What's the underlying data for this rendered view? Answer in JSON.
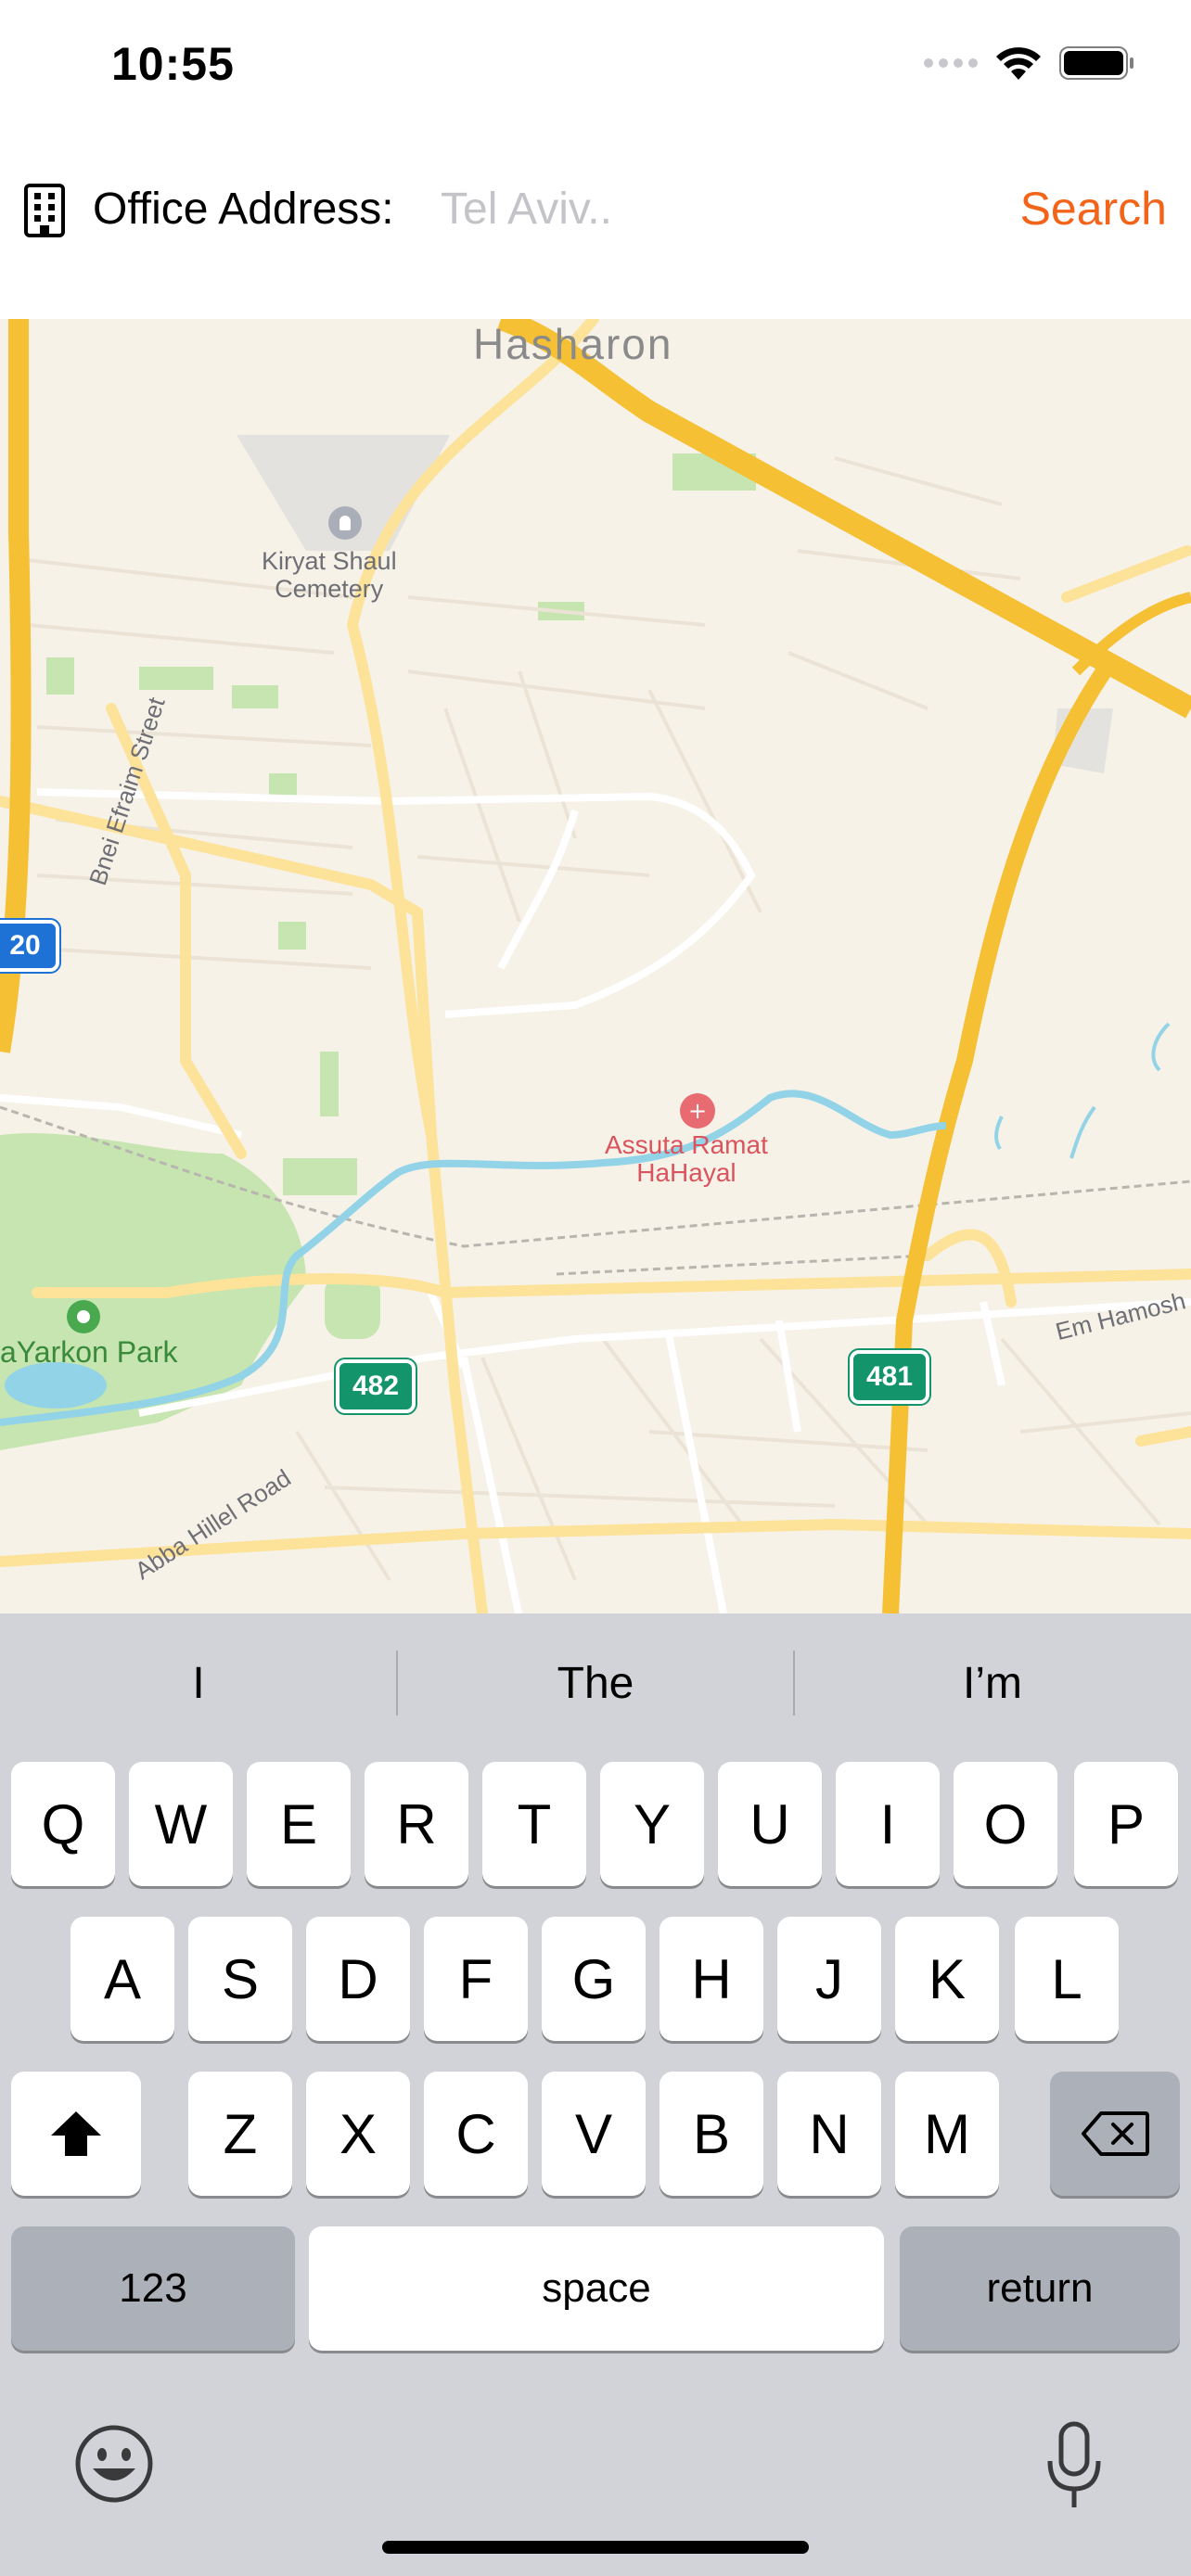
{
  "status_bar": {
    "time": "10:55",
    "icons": [
      "cellular-signal-icon",
      "wifi-icon",
      "battery-icon"
    ]
  },
  "address_bar": {
    "icon": "building-icon",
    "label": "Office Address:",
    "placeholder": "Tel Aviv..",
    "value": "",
    "search_label": "Search"
  },
  "map": {
    "labels": {
      "area": "Hasharon",
      "cemetery_line1": "Kiryat Shaul",
      "cemetery_line2": "Cemetery",
      "street_bnei_efraim": "Bnei Efraim Street",
      "highway_20": "20",
      "hospital_line1": "Assuta Ramat",
      "hospital_line2": "HaHayal",
      "park": "aYarkon Park",
      "route_482": "482",
      "route_481": "481",
      "street_abba_hillel": "Abba Hillel Road",
      "street_em_hamosh": "Em Hamosh"
    },
    "colors": {
      "land": "#f7f2e8",
      "highway": "#f7c844",
      "road": "#ffffff",
      "park": "#c6e5b0",
      "water": "#92d3e8"
    }
  },
  "keyboard": {
    "suggestions": [
      "I",
      "The",
      "I’m"
    ],
    "row1": [
      "Q",
      "W",
      "E",
      "R",
      "T",
      "Y",
      "U",
      "I",
      "O",
      "P"
    ],
    "row2": [
      "A",
      "S",
      "D",
      "F",
      "G",
      "H",
      "J",
      "K",
      "L"
    ],
    "row3": [
      "Z",
      "X",
      "C",
      "V",
      "B",
      "N",
      "M"
    ],
    "numbers_label": "123",
    "space_label": "space",
    "return_label": "return",
    "icons": [
      "shift-icon",
      "backspace-icon",
      "emoji-icon",
      "microphone-icon"
    ]
  }
}
